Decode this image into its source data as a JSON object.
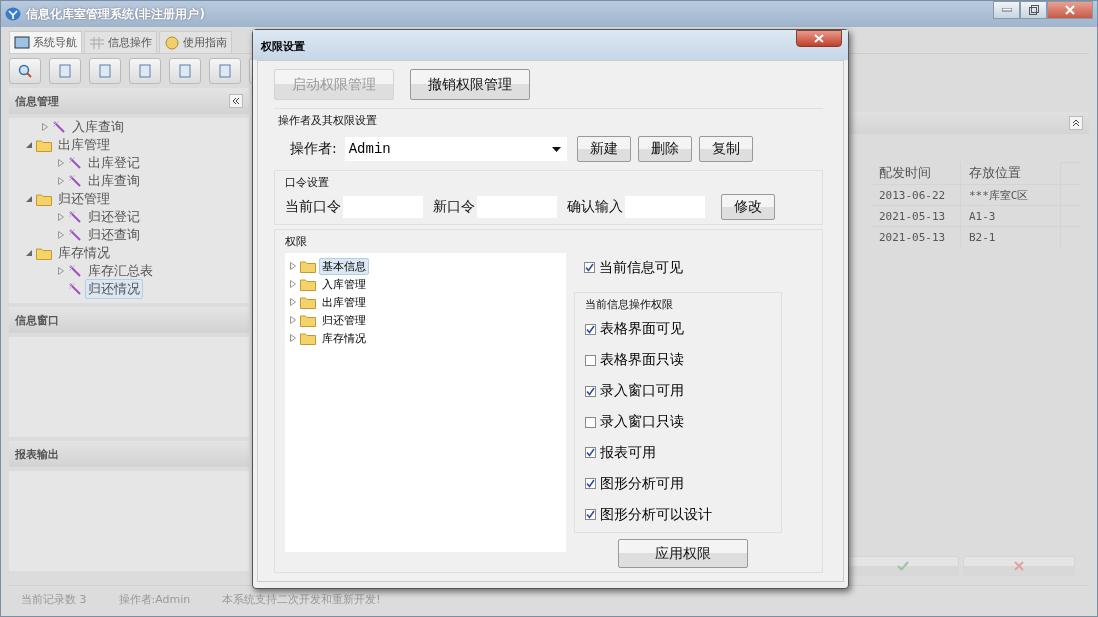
{
  "window": {
    "title": "信息化库室管理系统(非注册用户)"
  },
  "tabs": [
    {
      "label": "系统导航",
      "selected": true
    },
    {
      "label": "信息操作",
      "selected": false
    },
    {
      "label": "使用指南",
      "selected": false
    }
  ],
  "sidebar": {
    "title": "信息管理",
    "tree": [
      {
        "kind": "leaf",
        "label": "入库查询",
        "selected": false
      },
      {
        "kind": "folder",
        "label": "出库管理",
        "expanded": true,
        "children": [
          {
            "kind": "leaf",
            "label": "出库登记",
            "selected": false
          },
          {
            "kind": "leaf",
            "label": "出库查询",
            "selected": false
          }
        ]
      },
      {
        "kind": "folder",
        "label": "归还管理",
        "expanded": true,
        "children": [
          {
            "kind": "leaf",
            "label": "归还登记",
            "selected": false
          },
          {
            "kind": "leaf",
            "label": "归还查询",
            "selected": false
          }
        ]
      },
      {
        "kind": "folder",
        "label": "库存情况",
        "expanded": true,
        "children": [
          {
            "kind": "leaf",
            "label": "库存汇总表",
            "selected": false
          },
          {
            "kind": "leaf",
            "label": "归还情况",
            "selected": true
          }
        ]
      }
    ],
    "panels": [
      {
        "title": "信息窗口"
      },
      {
        "title": "报表输出"
      }
    ]
  },
  "table": {
    "columns": [
      "配发时间",
      "存放位置"
    ],
    "rows": [
      [
        "2013-06-22",
        "***库室C区"
      ],
      [
        "2021-05-13",
        "A1-3"
      ],
      [
        "2021-05-13",
        "B2-1"
      ]
    ]
  },
  "status_bar": [
    "当前记录数 3",
    "操作者:Admin",
    "本系统支持二次开发和重新开发!"
  ],
  "dialog": {
    "title": "权限设置",
    "top_buttons": [
      {
        "label": "启动权限管理",
        "disabled": true
      },
      {
        "label": "撤销权限管理",
        "disabled": false
      }
    ],
    "operator_group": "操作者及其权限设置",
    "operator_label": "操作者:",
    "operator_value": "Admin",
    "operator_buttons": [
      "新建",
      "删除",
      "复制"
    ],
    "password_group": "口令设置",
    "password_fields": [
      {
        "label": "当前口令"
      },
      {
        "label": "新口令"
      },
      {
        "label": "确认输入"
      }
    ],
    "password_button": "修改",
    "permission_group": "权限",
    "tree": [
      {
        "label": "基本信息",
        "expanded": false,
        "selected": true
      },
      {
        "label": "入库管理",
        "expanded": false,
        "selected": false
      },
      {
        "label": "出库管理",
        "expanded": false,
        "selected": false
      },
      {
        "label": "归还管理",
        "expanded": false,
        "selected": false
      },
      {
        "label": "库存情况",
        "expanded": false,
        "selected": false
      }
    ],
    "visible": {
      "label": "当前信息可见",
      "checked": true
    },
    "ops_group": "当前信息操作权限",
    "ops": [
      {
        "label": "表格界面可见",
        "checked": true
      },
      {
        "label": "表格界面只读",
        "checked": false
      },
      {
        "label": "录入窗口可用",
        "checked": true
      },
      {
        "label": "录入窗口只读",
        "checked": false
      },
      {
        "label": "报表可用",
        "checked": true
      },
      {
        "label": "图形分析可用",
        "checked": true
      },
      {
        "label": "图形分析可以设计",
        "checked": true
      }
    ],
    "apply_button": "应用权限"
  }
}
